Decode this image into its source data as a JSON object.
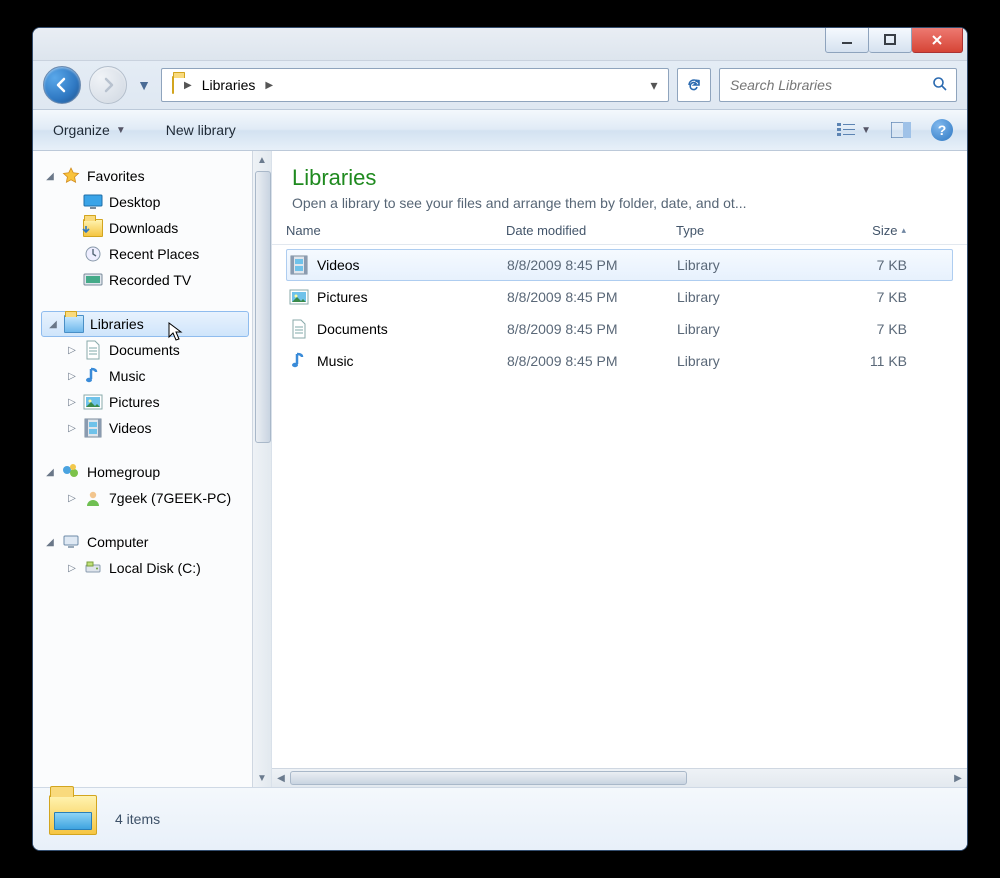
{
  "breadcrumb": {
    "current": "Libraries"
  },
  "search": {
    "placeholder": "Search Libraries"
  },
  "cmdbar": {
    "organize": "Organize",
    "newlibrary": "New library"
  },
  "nav": {
    "favorites_label": "Favorites",
    "favorites": [
      {
        "label": "Desktop",
        "icon": "desktop"
      },
      {
        "label": "Downloads",
        "icon": "download-folder"
      },
      {
        "label": "Recent Places",
        "icon": "recent"
      },
      {
        "label": "Recorded TV",
        "icon": "tv"
      }
    ],
    "libraries_label": "Libraries",
    "libraries": [
      {
        "label": "Documents",
        "icon": "doc"
      },
      {
        "label": "Music",
        "icon": "music"
      },
      {
        "label": "Pictures",
        "icon": "pic"
      },
      {
        "label": "Videos",
        "icon": "vid"
      }
    ],
    "homegroup_label": "Homegroup",
    "homegroup_item": "7geek (7GEEK-PC)",
    "computer_label": "Computer",
    "computer_item": "Local Disk (C:)"
  },
  "content": {
    "title": "Libraries",
    "subtitle": "Open a library to see your files and arrange them by folder, date, and ot...",
    "columns": {
      "name": "Name",
      "date": "Date modified",
      "type": "Type",
      "size": "Size"
    },
    "rows": [
      {
        "name": "Videos",
        "date": "8/8/2009 8:45 PM",
        "type": "Library",
        "size": "7 KB",
        "icon": "vid",
        "selected": true
      },
      {
        "name": "Pictures",
        "date": "8/8/2009 8:45 PM",
        "type": "Library",
        "size": "7 KB",
        "icon": "pic"
      },
      {
        "name": "Documents",
        "date": "8/8/2009 8:45 PM",
        "type": "Library",
        "size": "7 KB",
        "icon": "doc"
      },
      {
        "name": "Music",
        "date": "8/8/2009 8:45 PM",
        "type": "Library",
        "size": "11 KB",
        "icon": "music"
      }
    ]
  },
  "status": {
    "text": "4 items"
  }
}
